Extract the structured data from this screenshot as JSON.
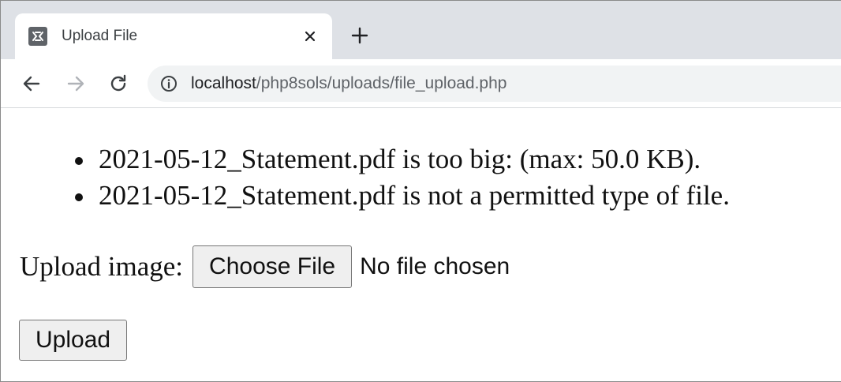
{
  "browser": {
    "tab": {
      "title": "Upload File",
      "favicon": "xampp-icon"
    },
    "toolbar": {
      "url_host": "localhost",
      "url_path": "/php8sols/uploads/file_upload.php"
    }
  },
  "page": {
    "errors": [
      "2021-05-12_Statement.pdf is too big: (max: 50.0 KB).",
      "2021-05-12_Statement.pdf is not a permitted type of file."
    ],
    "form": {
      "label": "Upload image:",
      "choose_button": "Choose File",
      "file_status": "No file chosen",
      "submit_button": "Upload"
    }
  },
  "colors": {
    "tabstrip": "#dee1e6",
    "omnibox": "#f1f3f4",
    "button_bg": "#efefef"
  }
}
